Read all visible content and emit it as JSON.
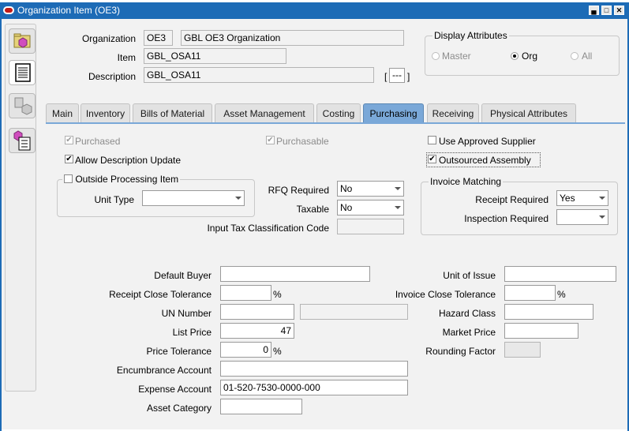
{
  "window": {
    "title": "Organization Item (OE3)"
  },
  "header": {
    "organization_label": "Organization",
    "organization_code": "OE3",
    "organization_name": "GBL OE3 Organization",
    "item_label": "Item",
    "item_value": "GBL_OSA11",
    "description_label": "Description",
    "description_value": "GBL_OSA11",
    "desc_flex_open": "[",
    "desc_flex_value": "---",
    "desc_flex_close": "]"
  },
  "display_attributes": {
    "title": "Display Attributes",
    "options": [
      {
        "label": "Master",
        "selected": false,
        "enabled": false
      },
      {
        "label": "Org",
        "selected": true,
        "enabled": true
      },
      {
        "label": "All",
        "selected": false,
        "enabled": false
      }
    ]
  },
  "tabs": [
    {
      "label": "Main",
      "active": false
    },
    {
      "label": "Inventory",
      "active": false
    },
    {
      "label": "Bills of Material",
      "active": false
    },
    {
      "label": "Asset Management",
      "active": false
    },
    {
      "label": "Costing",
      "active": false
    },
    {
      "label": "Purchasing",
      "active": true
    },
    {
      "label": "Receiving",
      "active": false
    },
    {
      "label": "Physical Attributes",
      "active": false
    }
  ],
  "purchasing": {
    "purchased": {
      "label": "Purchased",
      "checked": true,
      "enabled": false
    },
    "purchasable": {
      "label": "Purchasable",
      "checked": true,
      "enabled": false
    },
    "use_approved_supplier": {
      "label": "Use Approved Supplier",
      "checked": false
    },
    "allow_description_update": {
      "label": "Allow Description Update",
      "checked": true
    },
    "outsourced_assembly": {
      "label": "Outsourced Assembly",
      "checked": true
    },
    "outside_processing": {
      "label": "Outside Processing Item",
      "checked": false
    },
    "unit_type_label": "Unit Type",
    "unit_type_value": "",
    "rfq_required_label": "RFQ Required",
    "rfq_required_value": "No",
    "taxable_label": "Taxable",
    "taxable_value": "No",
    "input_tax_label": "Input Tax Classification Code",
    "input_tax_value": "",
    "invoice_matching_title": "Invoice Matching",
    "receipt_required_label": "Receipt Required",
    "receipt_required_value": "Yes",
    "inspection_required_label": "Inspection Required",
    "inspection_required_value": "",
    "default_buyer_label": "Default Buyer",
    "default_buyer_value": "",
    "receipt_close_tolerance_label": "Receipt Close Tolerance",
    "receipt_close_tolerance_value": "",
    "percent": "%",
    "un_number_label": "UN Number",
    "un_number_value": "",
    "un_number_desc": "",
    "list_price_label": "List Price",
    "list_price_value": "47",
    "price_tolerance_label": "Price Tolerance",
    "price_tolerance_value": "0",
    "encumbrance_account_label": "Encumbrance Account",
    "encumbrance_account_value": "",
    "expense_account_label": "Expense Account",
    "expense_account_value": "01-520-7530-0000-000",
    "asset_category_label": "Asset Category",
    "asset_category_value": "",
    "unit_of_issue_label": "Unit of Issue",
    "unit_of_issue_value": "",
    "invoice_close_tolerance_label": "Invoice Close Tolerance",
    "invoice_close_tolerance_value": "",
    "hazard_class_label": "Hazard Class",
    "hazard_class_value": "",
    "market_price_label": "Market Price",
    "market_price_value": "",
    "rounding_factor_label": "Rounding Factor",
    "rounding_factor_value": ""
  },
  "colors": {
    "titlebar": "#1d6bb6",
    "active_tab": "#7aa8d8",
    "background": "#f2f2f2"
  }
}
